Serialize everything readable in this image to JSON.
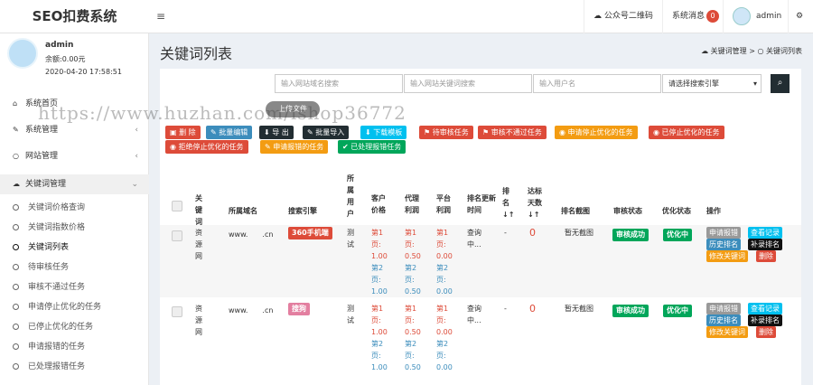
{
  "app": {
    "title": "SEO扣费系统"
  },
  "topbar": {
    "wechat_label": "公众号二维码",
    "sys_msg_label": "系统消息",
    "sys_msg_count": "0",
    "username": "admin"
  },
  "user": {
    "name": "admin",
    "balance": "余额:0.00元",
    "time": "2020-04-20 17:58:51"
  },
  "menu": {
    "home": "系统首页",
    "sys": "系统管理",
    "site": "网站管理",
    "kw": "关键词管理",
    "sub": [
      "关键词价格查询",
      "关键词指数价格",
      "关键词列表",
      "待审核任务",
      "审核不通过任务",
      "申请停止优化的任务",
      "已停止优化的任务",
      "申请报错的任务",
      "已处理报错任务"
    ]
  },
  "page": {
    "title": "关键词列表",
    "breadcrumb_parent": "关键词管理",
    "breadcrumb_current": "关键词列表"
  },
  "search": {
    "site_placeholder": "输入网站域名搜索",
    "kw_placeholder": "输入网站关键词搜索",
    "user_placeholder": "输入用户名",
    "engine_placeholder": "请选择搜索引擎"
  },
  "upload_label": "上传文件",
  "buttons": {
    "delete": "删 除",
    "batch_edit": "批量编辑",
    "export": "导 出",
    "batch_import": "批量导入",
    "download_tpl": "下载模板",
    "pending": "待审核任务",
    "rejected": "审核不通过任务",
    "apply_stop": "申请停止优化的任务",
    "stopped": "已停止优化的任务",
    "refuse_stop": "拒绝停止优化的任务",
    "apply_error": "申请报错的任务",
    "handled_error": "已处理报错任务"
  },
  "table": {
    "headers": [
      "关键词",
      "所属域名",
      "搜索引擎",
      "所属用户",
      "客户价格",
      "代理利润",
      "平台利润",
      "排名更新时间",
      "排名↓↑",
      "达标天数↓↑",
      "排名截图",
      "审核状态",
      "优化状态",
      "操作"
    ],
    "rows": [
      {
        "keyword": "资源网",
        "domain": "www.　　.cn",
        "engine": "360手机端",
        "user": "测试",
        "price": [
          "第1页:",
          "1.00",
          "第2页:",
          "1.00"
        ],
        "agent": [
          "第1页:",
          "0.50",
          "第2页:",
          "0.50"
        ],
        "platform": [
          "第1页:",
          "0.00",
          "第2页:",
          "0.00"
        ],
        "update": "查询中...",
        "rank": "-",
        "days": "0",
        "snapshot": "暂无截图",
        "audit": "审核成功",
        "opt": "优化中",
        "actions": [
          "申请报错",
          "查看记录",
          "历史排名",
          "补录排名",
          "修改关键词",
          "删除"
        ]
      },
      {
        "keyword": "资源网",
        "domain": "www.　　.cn",
        "engine": "搜狗",
        "user": "测试",
        "price": [
          "第1页:",
          "1.00",
          "第2页:",
          "1.00"
        ],
        "agent": [
          "第1页:",
          "0.50",
          "第2页:",
          "0.50"
        ],
        "platform": [
          "第1页:",
          "0.00",
          "第2页:",
          "0.00"
        ],
        "update": "查询中...",
        "rank": "-",
        "days": "0",
        "snapshot": "暂无截图",
        "audit": "审核成功",
        "opt": "优化中",
        "actions": [
          "申请报错",
          "查看记录",
          "历史排名",
          "补录排名",
          "修改关键词",
          "删除"
        ]
      }
    ]
  },
  "watermark": "https://www.huzhan.com/ishop36772",
  "colors": {
    "red": "#dd4b39",
    "blue": "#3c8dbc",
    "dark": "#222d32",
    "sky": "#00c0ef",
    "orange": "#f39c12",
    "green": "#00a65a"
  }
}
